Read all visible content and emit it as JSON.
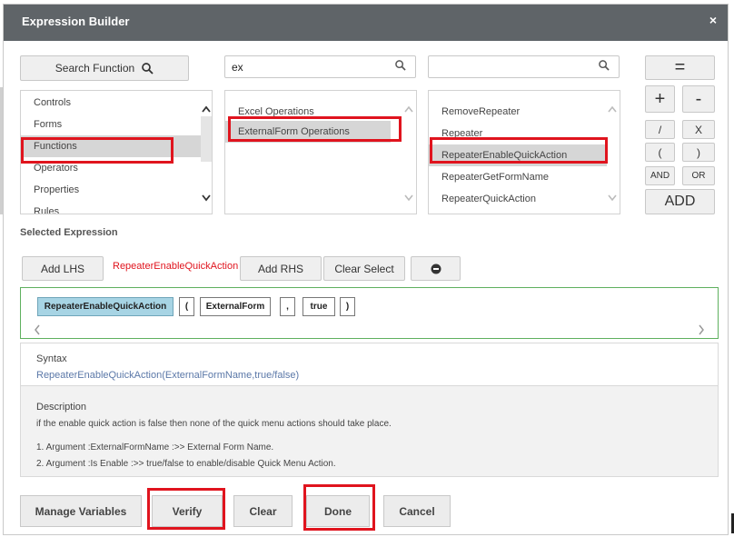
{
  "dialog": {
    "title": "Expression Builder",
    "close_label": "×"
  },
  "top": {
    "search_function_label": "Search Function",
    "search_value": "ex",
    "search2_value": "",
    "equals_label": "="
  },
  "categories": {
    "items": [
      "Controls",
      "Forms",
      "Functions",
      "Operators",
      "Properties",
      "Rules"
    ],
    "selected": "Functions"
  },
  "groups": {
    "items": [
      "Excel Operations",
      "ExternalForm Operations"
    ],
    "selected": "ExternalForm Operations"
  },
  "functions": {
    "items": [
      "RemoveRepeater",
      "Repeater",
      "RepeaterEnableQuickAction",
      "RepeaterGetFormName",
      "RepeaterQuickAction"
    ],
    "selected": "RepeaterEnableQuickAction"
  },
  "operators": {
    "plus": "+",
    "minus": "-",
    "divide": "/",
    "multiply": "X",
    "open_paren": "(",
    "close_paren": ")",
    "and": "AND",
    "or": "OR",
    "add": "ADD"
  },
  "selected_expression": {
    "label": "Selected Expression",
    "add_lhs": "Add LHS",
    "selection_text": "RepeaterEnableQuickAction",
    "add_rhs": "Add RHS",
    "clear_select": "Clear Select",
    "tokens": [
      "RepeaterEnableQuickAction",
      "(",
      "ExternalForm",
      ",",
      "true",
      ")"
    ]
  },
  "syntax": {
    "heading": "Syntax",
    "value": "RepeaterEnableQuickAction(ExternalFormName,true/false)"
  },
  "description": {
    "heading": "Description",
    "text": "if the enable quick action is false then none of the quick menu actions should take place.",
    "arg1": "1. Argument :ExternalFormName :>> External Form Name.",
    "arg2": "2. Argument :Is Enable :>> true/false to enable/disable Quick Menu Action."
  },
  "footer": {
    "manage_variables": "Manage Variables",
    "verify": "Verify",
    "clear": "Clear",
    "done": "Done",
    "cancel": "Cancel"
  },
  "colors": {
    "titlebar": "#5f6468",
    "highlight_red": "#e0141e",
    "token_highlight": "#a7d4e4",
    "expr_border": "#5fb05f",
    "syntax_text": "#5b78a8"
  }
}
